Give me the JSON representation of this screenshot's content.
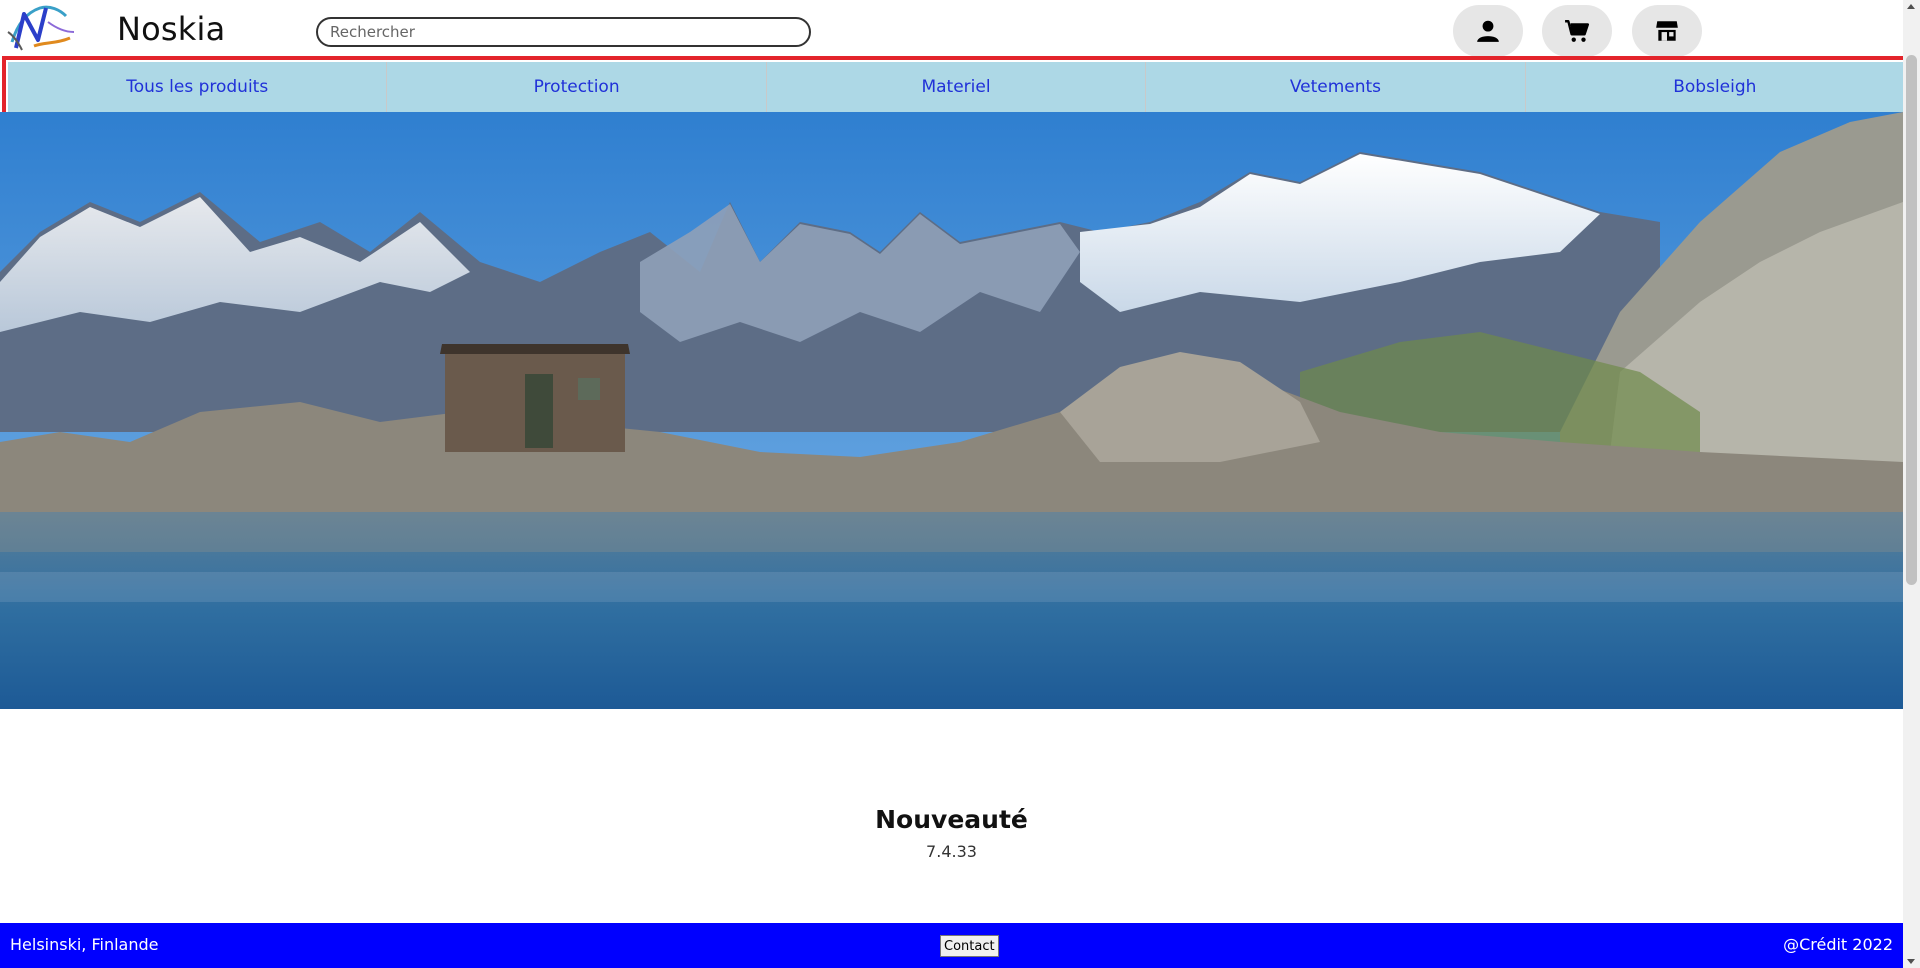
{
  "header": {
    "brand": "Noskia",
    "search_placeholder": "Rechercher"
  },
  "nav": {
    "items": [
      {
        "label": "Tous les produits"
      },
      {
        "label": "Protection"
      },
      {
        "label": "Materiel"
      },
      {
        "label": "Vetements"
      },
      {
        "label": "Bobsleigh"
      }
    ]
  },
  "main": {
    "section_title": "Nouveauté",
    "version": "7.4.33"
  },
  "footer": {
    "location": "Helsinski, Finlande",
    "contact_label": "Contact",
    "credit": "@Crédit 2022"
  },
  "icons": {
    "user": "user-icon",
    "cart": "cart-icon",
    "store": "store-icon"
  },
  "colors": {
    "nav_background": "#add8e6",
    "nav_text": "#2031d8",
    "nav_highlight_outline": "#e3242b",
    "footer_background": "#0000ff"
  }
}
